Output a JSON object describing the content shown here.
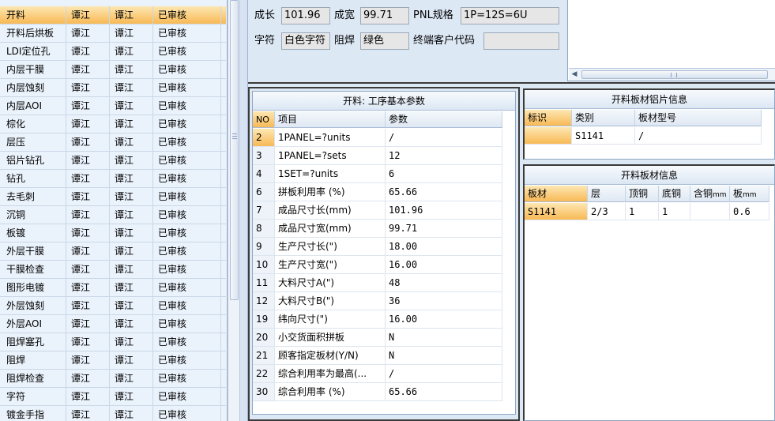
{
  "process_list": {
    "rows": [
      {
        "name": "开料",
        "c2": "谭江",
        "c3": "谭江",
        "status": "已审核",
        "selected": true
      },
      {
        "name": "开料后烘板",
        "c2": "谭江",
        "c3": "谭江",
        "status": "已审核"
      },
      {
        "name": "LDI定位孔",
        "c2": "谭江",
        "c3": "谭江",
        "status": "已审核"
      },
      {
        "name": "内层干膜",
        "c2": "谭江",
        "c3": "谭江",
        "status": "已审核"
      },
      {
        "name": "内层蚀刻",
        "c2": "谭江",
        "c3": "谭江",
        "status": "已审核"
      },
      {
        "name": "内层AOI",
        "c2": "谭江",
        "c3": "谭江",
        "status": "已审核"
      },
      {
        "name": "棕化",
        "c2": "谭江",
        "c3": "谭江",
        "status": "已审核"
      },
      {
        "name": "层压",
        "c2": "谭江",
        "c3": "谭江",
        "status": "已审核"
      },
      {
        "name": "铝片钻孔",
        "c2": "谭江",
        "c3": "谭江",
        "status": "已审核"
      },
      {
        "name": "钻孔",
        "c2": "谭江",
        "c3": "谭江",
        "status": "已审核"
      },
      {
        "name": "去毛刺",
        "c2": "谭江",
        "c3": "谭江",
        "status": "已审核"
      },
      {
        "name": "沉铜",
        "c2": "谭江",
        "c3": "谭江",
        "status": "已审核"
      },
      {
        "name": "板镀",
        "c2": "谭江",
        "c3": "谭江",
        "status": "已审核"
      },
      {
        "name": "外层干膜",
        "c2": "谭江",
        "c3": "谭江",
        "status": "已审核"
      },
      {
        "name": "干膜检查",
        "c2": "谭江",
        "c3": "谭江",
        "status": "已审核"
      },
      {
        "name": "图形电镀",
        "c2": "谭江",
        "c3": "谭江",
        "status": "已审核"
      },
      {
        "name": "外层蚀刻",
        "c2": "谭江",
        "c3": "谭江",
        "status": "已审核"
      },
      {
        "name": "外层AOI",
        "c2": "谭江",
        "c3": "谭江",
        "status": "已审核"
      },
      {
        "name": "阻焊塞孔",
        "c2": "谭江",
        "c3": "谭江",
        "status": "已审核"
      },
      {
        "name": "阻焊",
        "c2": "谭江",
        "c3": "谭江",
        "status": "已审核"
      },
      {
        "name": "阻焊检查",
        "c2": "谭江",
        "c3": "谭江",
        "status": "已审核"
      },
      {
        "name": "字符",
        "c2": "谭江",
        "c3": "谭江",
        "status": "已审核"
      },
      {
        "name": "镀金手指",
        "c2": "谭江",
        "c3": "谭江",
        "status": "已审核"
      }
    ]
  },
  "top_form": {
    "length_label": "成长",
    "length_value": "101.96",
    "width_label": "成宽",
    "width_value": "99.71",
    "pnl_label": "PNL规格",
    "pnl_value": "1P=12S=6U",
    "char_label": "字符",
    "char_value": "白色字符",
    "mask_label": "阻焊",
    "mask_value": "绿色",
    "customer_label": "终端客户代码",
    "customer_value": ""
  },
  "params_panel": {
    "title": "开料: 工序基本参数",
    "headers": {
      "no": "NO",
      "item": "项目",
      "param": "参数"
    },
    "rows": [
      {
        "no": "2",
        "item": "1PANEL=?units",
        "param": "/",
        "selected": true
      },
      {
        "no": "3",
        "item": "1PANEL=?sets",
        "param": "12"
      },
      {
        "no": "4",
        "item": "1SET=?units",
        "param": "6"
      },
      {
        "no": "6",
        "item": "拼板利用率 (%)",
        "param": "65.66"
      },
      {
        "no": "7",
        "item": "成品尺寸长(mm)",
        "param": "101.96"
      },
      {
        "no": "8",
        "item": "成品尺寸宽(mm)",
        "param": "99.71"
      },
      {
        "no": "9",
        "item": "生产尺寸长(\")",
        "param": "18.00"
      },
      {
        "no": "10",
        "item": "生产尺寸宽(\")",
        "param": "16.00"
      },
      {
        "no": "11",
        "item": "大料尺寸A(\")",
        "param": "48"
      },
      {
        "no": "12",
        "item": "大料尺寸B(\")",
        "param": "36"
      },
      {
        "no": "19",
        "item": "纬向尺寸(\")",
        "param": "16.00"
      },
      {
        "no": "20",
        "item": "小交货面积拼板",
        "param": "N"
      },
      {
        "no": "21",
        "item": "顾客指定板材(Y/N)",
        "param": "N"
      },
      {
        "no": "22",
        "item": "综合利用率为最高(...",
        "param": "/"
      },
      {
        "no": "30",
        "item": "综合利用率 (%)",
        "param": "65.66"
      }
    ]
  },
  "foil_panel": {
    "title": "开料板材铝片信息",
    "headers": {
      "mark": "标识",
      "category": "类别",
      "model": "板材型号"
    },
    "row": {
      "mark": "",
      "category": "S1141",
      "model": "/"
    }
  },
  "board_panel": {
    "title": "开料板材信息",
    "headers": {
      "board": "板材",
      "layer": "层",
      "top_cu": "顶铜",
      "bottom_cu": "底铜",
      "cu_thick": "含铜",
      "cu_thick_unit": "mm",
      "thick": "板",
      "thick_unit": "mm"
    },
    "row": {
      "board": "S1141",
      "layer": "2/3",
      "top_cu": "1",
      "bottom_cu": "1",
      "cu_thick": "",
      "thick": "0.6"
    }
  }
}
